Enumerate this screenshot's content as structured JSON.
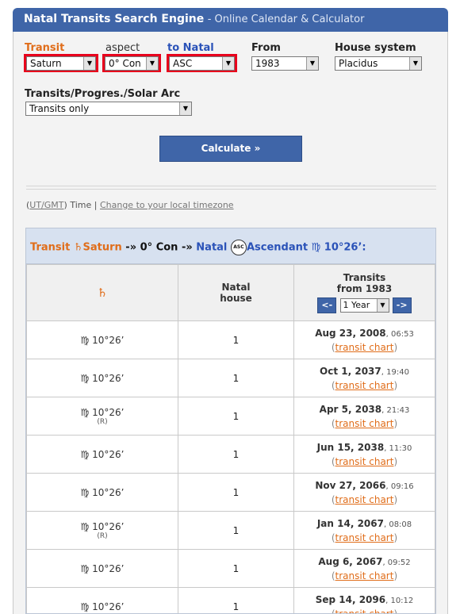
{
  "header": {
    "title": "Natal Transits Search Engine",
    "subtitle": "- Online Calendar & Calculator"
  },
  "form": {
    "transit_label": "Transit",
    "transit_value": "Saturn",
    "aspect_label": "aspect",
    "aspect_value": "0° Con",
    "natal_label": "to Natal",
    "natal_value": "ASC",
    "from_label": "From",
    "from_value": "1983",
    "house_label": "House system",
    "house_value": "Placidus",
    "mode_label": "Transits/Progres./Solar Arc",
    "mode_value": "Transits only",
    "calculate_label": "Calculate »",
    "dropdown_arrow": "▼"
  },
  "timezone": {
    "ut": "UT/GMT",
    "time": "Time",
    "change": "Change to your local timezone"
  },
  "results": {
    "heading": {
      "transit": "Transit",
      "planet": "Saturn",
      "arrow1": "-»",
      "aspect": "0° Con",
      "arrow2": "-»",
      "natal": "Natal",
      "asc_badge": "ASC",
      "point": "Ascendant",
      "position": "10°26’:"
    },
    "columns": {
      "planet_glyph": "♄",
      "natal_house": "Natal\nhouse",
      "transits": "Transits",
      "from": "from 1983",
      "prev": "<-",
      "period": "1 Year",
      "next": "->"
    },
    "chart_link": "transit chart",
    "rows": [
      {
        "sign": "♍",
        "pos": "10°26’",
        "retro": "",
        "house": "1",
        "date": "Aug 23, 2008",
        "time": ", 06:53"
      },
      {
        "sign": "♍",
        "pos": "10°26’",
        "retro": "",
        "house": "1",
        "date": "Oct 1, 2037",
        "time": ", 19:40"
      },
      {
        "sign": "♍",
        "pos": "10°26’",
        "retro": "(R)",
        "house": "1",
        "date": "Apr 5, 2038",
        "time": ", 21:43"
      },
      {
        "sign": "♍",
        "pos": "10°26’",
        "retro": "",
        "house": "1",
        "date": "Jun 15, 2038",
        "time": ", 11:30"
      },
      {
        "sign": "♍",
        "pos": "10°26’",
        "retro": "",
        "house": "1",
        "date": "Nov 27, 2066",
        "time": ", 09:16"
      },
      {
        "sign": "♍",
        "pos": "10°26’",
        "retro": "(R)",
        "house": "1",
        "date": "Jan 14, 2067",
        "time": ", 08:08"
      },
      {
        "sign": "♍",
        "pos": "10°26’",
        "retro": "",
        "house": "1",
        "date": "Aug 6, 2067",
        "time": ", 09:52"
      },
      {
        "sign": "♍",
        "pos": "10°26’",
        "retro": "",
        "house": "1",
        "date": "Sep 14, 2096",
        "time": ", 10:12"
      }
    ]
  },
  "colors": {
    "accent_blue": "#3f65a8",
    "transit_orange": "#e06d1a",
    "highlight_red": "#e8001c"
  }
}
